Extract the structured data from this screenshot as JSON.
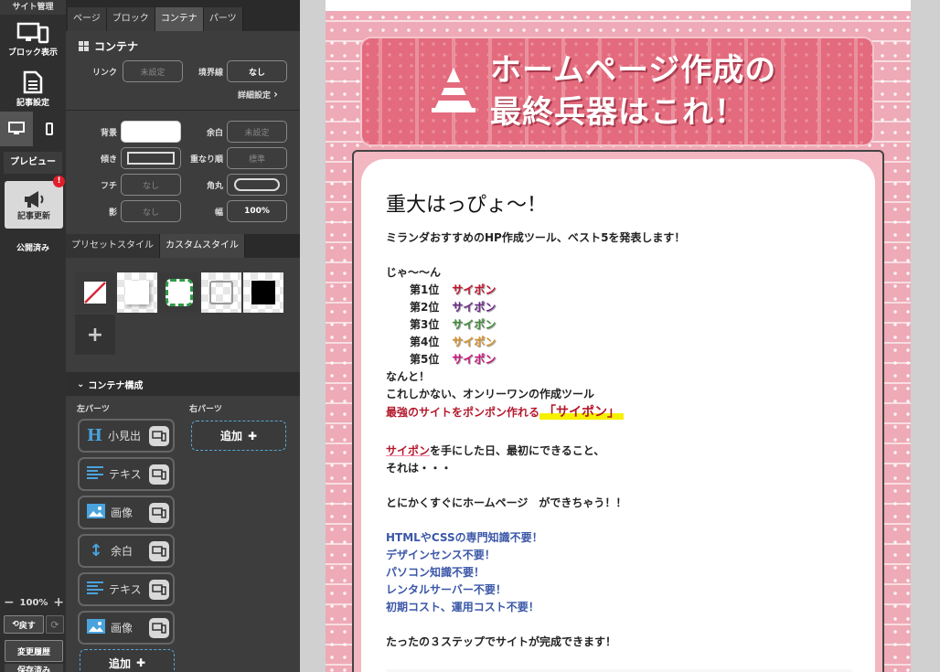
{
  "rail": {
    "header": "サイト管理",
    "block_view": "ブロック表示",
    "article_settings": "記事設定",
    "preview": "プレビュー",
    "update_article": "記事更新",
    "update_badge": "!",
    "published": "公開済み",
    "zoom": "100%",
    "undo": "戻す",
    "history": "変更履歴",
    "save": "保存済み"
  },
  "panel": {
    "tabs": [
      {
        "label": "ページ",
        "active": false
      },
      {
        "label": "ブロック",
        "active": false
      },
      {
        "label": "コンテナ",
        "active": true
      },
      {
        "label": "パーツ",
        "active": false
      }
    ],
    "section_title": "コンテナ",
    "fields": {
      "link_label": "リンク",
      "link_value": "未設定",
      "border_label": "境界線",
      "border_value": "なし",
      "detail_settings": "詳細設定",
      "bg_label": "背景",
      "margin_label": "余白",
      "margin_value": "未設定",
      "tilt_label": "傾き",
      "order_label": "重なり順",
      "order_value": "標準",
      "edge_label": "フチ",
      "edge_value": "なし",
      "radius_label": "角丸",
      "shadow_label": "影",
      "shadow_value": "なし",
      "width_label": "幅",
      "width_value": "100%"
    },
    "style_tabs": [
      {
        "label": "プリセットスタイル",
        "active": false
      },
      {
        "label": "カスタムスタイル",
        "active": true
      }
    ],
    "composition_title": "コンテナ構成",
    "left_parts_label": "左パーツ",
    "right_parts_label": "右パーツ",
    "left_parts": [
      {
        "label": "小見出",
        "icon": "heading-icon"
      },
      {
        "label": "テキス",
        "icon": "text-icon"
      },
      {
        "label": "画像",
        "icon": "image-icon"
      },
      {
        "label": "余白",
        "icon": "spacer-icon"
      },
      {
        "label": "テキス",
        "icon": "text-icon"
      },
      {
        "label": "画像",
        "icon": "image-icon"
      }
    ],
    "add_label": "追加"
  },
  "page": {
    "hero_line1": "ホームページ作成の",
    "hero_line2": "最終兵器はこれ！",
    "title": "重大はっぴょ～！",
    "intro": "ミランダおすすめのHP作成ツール、ベスト5を発表します！",
    "jaan": "じゃ～～ん",
    "ranks": [
      {
        "rank": "第1位",
        "name": "サイポン",
        "color": "#c0152d"
      },
      {
        "rank": "第2位",
        "name": "サイポン",
        "color": "#6a2a86"
      },
      {
        "rank": "第3位",
        "name": "サイポン",
        "color": "#3f8a3b"
      },
      {
        "rank": "第4位",
        "name": "サイポン",
        "color": "#d6922a"
      },
      {
        "rank": "第5位",
        "name": "サイポン",
        "color": "#c8157a"
      }
    ],
    "nanto": "なんと！",
    "only_one": "これしかない、オンリーワンの作成ツール",
    "strongest": "最強のサイトをポンポン作れる",
    "saipon_quote": "「サイポン」",
    "saipon_word": "サイポン",
    "got_it": "を手にした日、最初にできること、",
    "soreha": "それは・・・",
    "anyway": "とにかくすぐにホームページ　ができちゃう！！",
    "benefits": [
      "HTMLやCSSの専門知識不要！",
      "デザインセンス不要！",
      "パソコン知識不要！",
      "レンタルサーバー不要！",
      "初期コスト、運用コスト不要！"
    ],
    "three_steps": "たったの３ステップでサイトが完成できます！"
  }
}
